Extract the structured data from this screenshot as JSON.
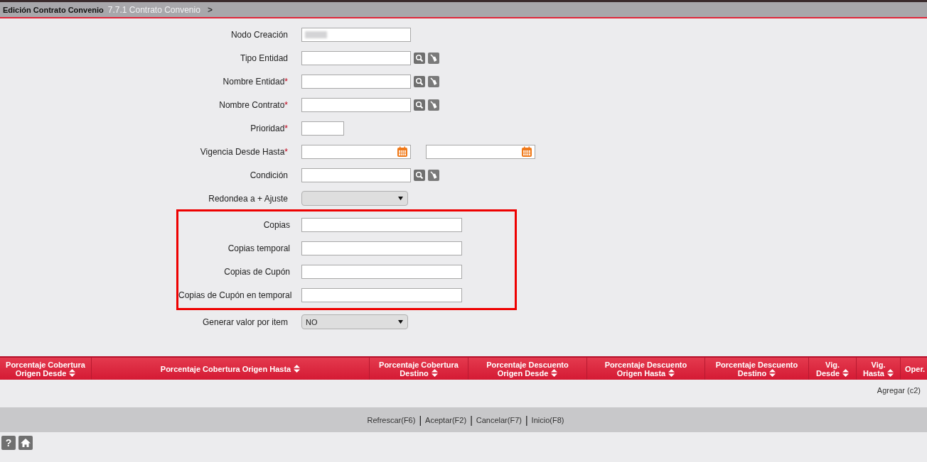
{
  "breadcrumb": {
    "title": "Edición Contrato Convenio",
    "path": "7.7.1 Contrato Convenio",
    "separator": ">"
  },
  "form": {
    "fields": [
      {
        "kind": "readonly",
        "label": "Nodo Creación",
        "redacted": true
      },
      {
        "kind": "lookup",
        "label": "Tipo Entidad"
      },
      {
        "kind": "lookup",
        "label": "Nombre Entidad",
        "marker": "*"
      },
      {
        "kind": "lookup",
        "label": "Nombre Contrato",
        "marker": "*"
      },
      {
        "kind": "short",
        "label": "Prioridad",
        "marker": "*"
      },
      {
        "kind": "daterange",
        "label": "Vigencia Desde Hasta",
        "marker": "*"
      },
      {
        "kind": "lookup",
        "label": "Condición"
      },
      {
        "kind": "select",
        "label": "Redondea a + Ajuste"
      },
      {
        "kind": "wide",
        "label": "Copias",
        "highlighted": true
      },
      {
        "kind": "wide",
        "label": "Copias temporal",
        "highlighted": true
      },
      {
        "kind": "wide",
        "label": "Copias de Cupón",
        "highlighted": true
      },
      {
        "kind": "wide",
        "label": "Copias de Cupón en temporal",
        "highlighted": true
      },
      {
        "kind": "select",
        "label": "Generar valor por item",
        "value": "NO"
      }
    ]
  },
  "table": {
    "columns": [
      {
        "label": "Porcentaje Cobertura Origen Desde",
        "sortable": true
      },
      {
        "label": "Porcentaje Cobertura Origen Hasta",
        "sortable": true
      },
      {
        "label": "Porcentaje Cobertura Destino",
        "sortable": true
      },
      {
        "label": "Porcentaje Descuento Origen Desde",
        "sortable": true
      },
      {
        "label": "Porcentaje Descuento Origen Hasta",
        "sortable": true
      },
      {
        "label": "Porcentaje Descuento Destino",
        "sortable": true
      },
      {
        "label": "Vig. Desde",
        "sortable": true
      },
      {
        "label": "Vig. Hasta",
        "sortable": true
      },
      {
        "label": "Oper.",
        "sortable": false
      }
    ],
    "add_link": "Agregar (c2)"
  },
  "footer": {
    "actions": [
      "Refrescar(F6)",
      "Aceptar(F2)",
      "Cancelar(F7)",
      "Inicio(F8)"
    ],
    "separator": "|"
  },
  "bottom_bar": {
    "help_glyph": "?"
  }
}
